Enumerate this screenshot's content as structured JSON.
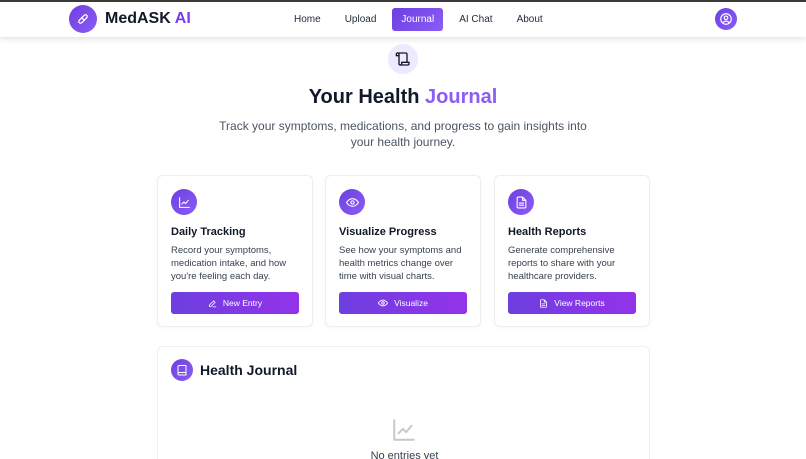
{
  "brand": {
    "name": "MedASK",
    "ai": "AI"
  },
  "nav": {
    "items": [
      {
        "label": "Home",
        "active": false
      },
      {
        "label": "Upload",
        "active": false
      },
      {
        "label": "Journal",
        "active": true
      },
      {
        "label": "AI Chat",
        "active": false
      },
      {
        "label": "About",
        "active": false
      }
    ]
  },
  "hero": {
    "title_main": "Your Health",
    "title_accent": "Journal",
    "subtitle": "Track your symptoms, medications, and progress to gain insights into your health journey."
  },
  "cards": [
    {
      "icon": "chart-line-icon",
      "title": "Daily Tracking",
      "description": "Record your symptoms, medication intake, and how you're feeling each day.",
      "button": "New Entry",
      "button_icon": "pencil-icon"
    },
    {
      "icon": "eye-icon",
      "title": "Visualize Progress",
      "description": "See how your symptoms and health metrics change over time with visual charts.",
      "button": "Visualize",
      "button_icon": "eye-icon"
    },
    {
      "icon": "document-icon",
      "title": "Health Reports",
      "description": "Generate comprehensive reports to share with your healthcare providers.",
      "button": "View Reports",
      "button_icon": "document-icon"
    }
  ],
  "journal": {
    "icon": "book-icon",
    "title": "Health Journal",
    "empty_icon": "chart-line-icon",
    "empty_text": "No entries yet"
  },
  "colors": {
    "accent": "#7c3aed",
    "accent_light": "#8b5cf6",
    "accent_bg": "#ede9fe"
  }
}
